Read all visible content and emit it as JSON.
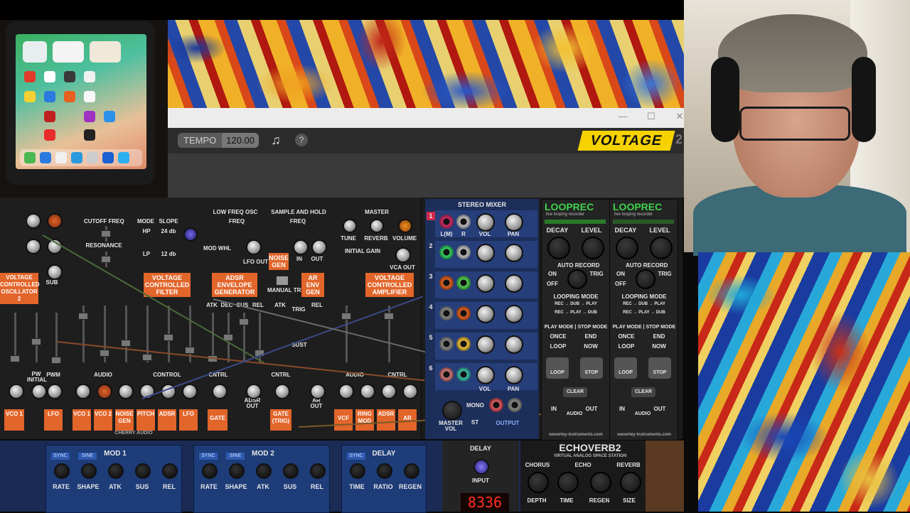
{
  "window": {
    "tempo_label": "TEMPO",
    "tempo_value": "120.00",
    "brand": "VOLTAGE",
    "brand_suffix": "2",
    "help_icon": "?"
  },
  "synth": {
    "cutoff": "CUTOFF FREQ",
    "resonance": "RESONANCE",
    "mode": "MODE",
    "hp": "HP",
    "lp": "LP",
    "slope": "SLOPE",
    "db24": "24 db",
    "db12": "12 db",
    "low_freq_osc": "LOW FREQ OSC",
    "freq": "FREQ",
    "mod_whl": "MOD WHL",
    "lfo_out": "LFO OUT",
    "sample_hold": "SAMPLE AND HOLD",
    "noise_gen": "NOISE GEN",
    "in": "IN",
    "out": "OUT",
    "master": "MASTER",
    "tune": "TUNE",
    "reverb": "REVERB",
    "volume": "VOLUME",
    "initial_gain": "INITIAL GAIN",
    "vca_out": "VCA OUT",
    "vco2": "VOLTAGE CONTROLLED OSCILLATOR 2",
    "vcf": "VOLTAGE CONTROLLED FILTER",
    "adsr": "ADSR ENVELOPE GENERATOR",
    "manual_trig": "MANUAL TRIG",
    "ar_env": "AR ENV GEN",
    "vca": "VOLTAGE CONTROLLED AMPLIFIER",
    "atk": "ATK",
    "dec": "DEC",
    "sus": "SUS",
    "rel": "REL",
    "trig": "TRIG",
    "sust": "SUST",
    "sub": "SUB",
    "pw_initial": "PW INITIAL",
    "pwm": "PWM",
    "audio": "AUDIO",
    "control": "CONTROL",
    "cntrl": "CNTRL",
    "adsr_out": "ADSR OUT",
    "ar_out": "AR OUT",
    "bottom_labels": [
      "VCO 1",
      "LFO",
      "VCO 1",
      "VCO 2",
      "NOISE GEN",
      "PITCH",
      "ADSR",
      "LFO",
      "GATE",
      "GATE (TRIG)",
      "VCF",
      "RING MOD",
      "ADSR",
      "AR"
    ],
    "maker": "CHERRY AUDIO"
  },
  "mixer": {
    "title": "STEREO MIXER",
    "channels": [
      "1",
      "2",
      "3",
      "4",
      "5",
      "6"
    ],
    "l_mono": "L(M)",
    "r": "R",
    "vol": "VOL",
    "pan": "PAN",
    "master_vol": "MASTER VOL",
    "mono": "MONO",
    "st": "ST",
    "output": "OUTPUT",
    "l": "L"
  },
  "looprec": {
    "title": "LOOPREC",
    "subtitle": "live looping recorder",
    "decay": "DECAY",
    "level": "LEVEL",
    "loop": "LOOP",
    "auto_record": "AUTO RECORD",
    "on": "ON",
    "off": "OFF",
    "trig": "TRIG",
    "looping_mode": "LOOPING MODE",
    "mode1": "REC → DUB → PLAY",
    "mode2": "REC → PLAY → DUB",
    "play_stop": "PLAY MODE | STOP MODE",
    "once": "ONCE",
    "end": "END",
    "loop_opt": "LOOP",
    "now": "NOW",
    "loop_btn": "LOOP",
    "stop_btn": "STOP",
    "clear": "CLEAR",
    "audio": "AUDIO",
    "in": "IN",
    "out": "OUT",
    "url": "waverley-instruments.com"
  },
  "lower": {
    "mod1": "MOD 1",
    "mod2": "MOD 2",
    "delay": "DELAY",
    "sync": "SYNC",
    "sine": "SINE",
    "rate": "RATE",
    "shape": "SHAPE",
    "atk": "ATK",
    "sus": "SUS",
    "rel": "REL",
    "time": "TIME",
    "ratio": "RATIO",
    "regen": "REGEN",
    "input": "INPUT",
    "display": "8336",
    "echoverb": "ECHOVERB2",
    "echoverb_sub": "VIRTUAL ANALOG SPACE STATION",
    "chorus": "CHORUS",
    "echo": "ECHO",
    "reverb": "REVERB",
    "depth": "DEPTH",
    "size": "SIZE"
  },
  "colors": {
    "accent_orange": "#e2652a",
    "brand_yellow": "#f6d200",
    "mixer_blue": "#1c2e5a",
    "loop_green": "#3ed24a"
  }
}
